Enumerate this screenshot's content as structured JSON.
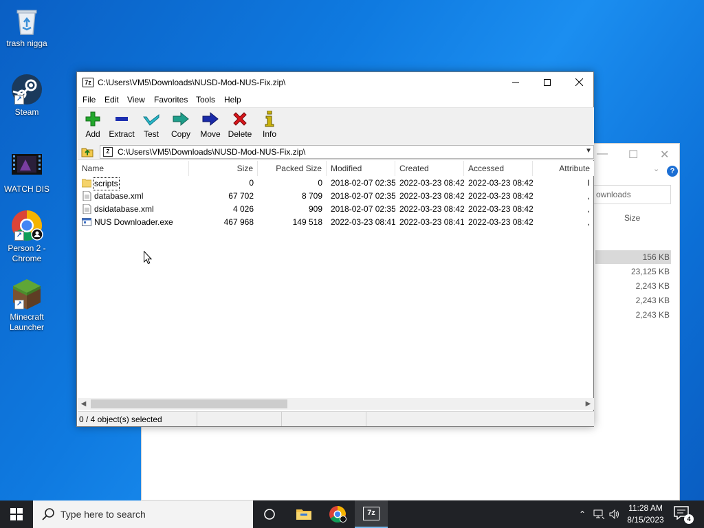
{
  "desktop": {
    "icons": [
      {
        "label": "trash nigga",
        "icon": "recycle-bin-icon"
      },
      {
        "label": "Steam",
        "icon": "steam-icon"
      },
      {
        "label": "WATCH DIS",
        "icon": "video-file-icon"
      },
      {
        "label": "Person 2 - Chrome",
        "icon": "chrome-icon"
      },
      {
        "label": "Minecraft Launcher",
        "icon": "minecraft-icon"
      }
    ]
  },
  "explorer_bg": {
    "search_placeholder": "ownloads",
    "size_header": "Size",
    "sizes": [
      "156 KB",
      "23,125 KB",
      "2,243 KB",
      "2,243 KB",
      "2,243 KB"
    ]
  },
  "sevenzip": {
    "title": "C:\\Users\\VM5\\Downloads\\NUSD-Mod-NUS-Fix.zip\\",
    "title_icon": "7z",
    "menu": [
      "File",
      "Edit",
      "View",
      "Favorites",
      "Tools",
      "Help"
    ],
    "toolbar": [
      {
        "label": "Add",
        "icon": "plus-icon",
        "color": "#22a82c"
      },
      {
        "label": "Extract",
        "icon": "minus-icon",
        "color": "#1d2fb0"
      },
      {
        "label": "Test",
        "icon": "check-icon",
        "color": "#29b6c8"
      },
      {
        "label": "Copy",
        "icon": "copy-arrow-icon",
        "color": "#1f9e8a"
      },
      {
        "label": "Move",
        "icon": "move-arrow-icon",
        "color": "#1a2aa8"
      },
      {
        "label": "Delete",
        "icon": "delete-x-icon",
        "color": "#d8161b"
      },
      {
        "label": "Info",
        "icon": "info-icon",
        "color": "#c9b20c"
      }
    ],
    "address": "C:\\Users\\VM5\\Downloads\\NUSD-Mod-NUS-Fix.zip\\",
    "columns": [
      "Name",
      "Size",
      "Packed Size",
      "Modified",
      "Created",
      "Accessed",
      "Attribute"
    ],
    "files": [
      {
        "name": "scripts",
        "type": "folder",
        "size": "0",
        "packed": "0",
        "modified": "2018-02-07 02:35",
        "created": "2022-03-23 08:42",
        "accessed": "2022-03-23 08:42",
        "attr": "I"
      },
      {
        "name": "database.xml",
        "type": "xml",
        "size": "67 702",
        "packed": "8 709",
        "modified": "2018-02-07 02:35",
        "created": "2022-03-23 08:42",
        "accessed": "2022-03-23 08:42",
        "attr": ","
      },
      {
        "name": "dsidatabase.xml",
        "type": "xml",
        "size": "4 026",
        "packed": "909",
        "modified": "2018-02-07 02:35",
        "created": "2022-03-23 08:42",
        "accessed": "2022-03-23 08:42",
        "attr": ","
      },
      {
        "name": "NUS Downloader.exe",
        "type": "exe",
        "size": "467 968",
        "packed": "149 518",
        "modified": "2022-03-23 08:41",
        "created": "2022-03-23 08:41",
        "accessed": "2022-03-23 08:42",
        "attr": ","
      }
    ],
    "status": "0 / 4 object(s) selected"
  },
  "taskbar": {
    "search_placeholder": "Type here to search",
    "time": "11:28 AM",
    "date": "8/15/2023",
    "notification_count": "4",
    "active_app_label": "7z"
  }
}
